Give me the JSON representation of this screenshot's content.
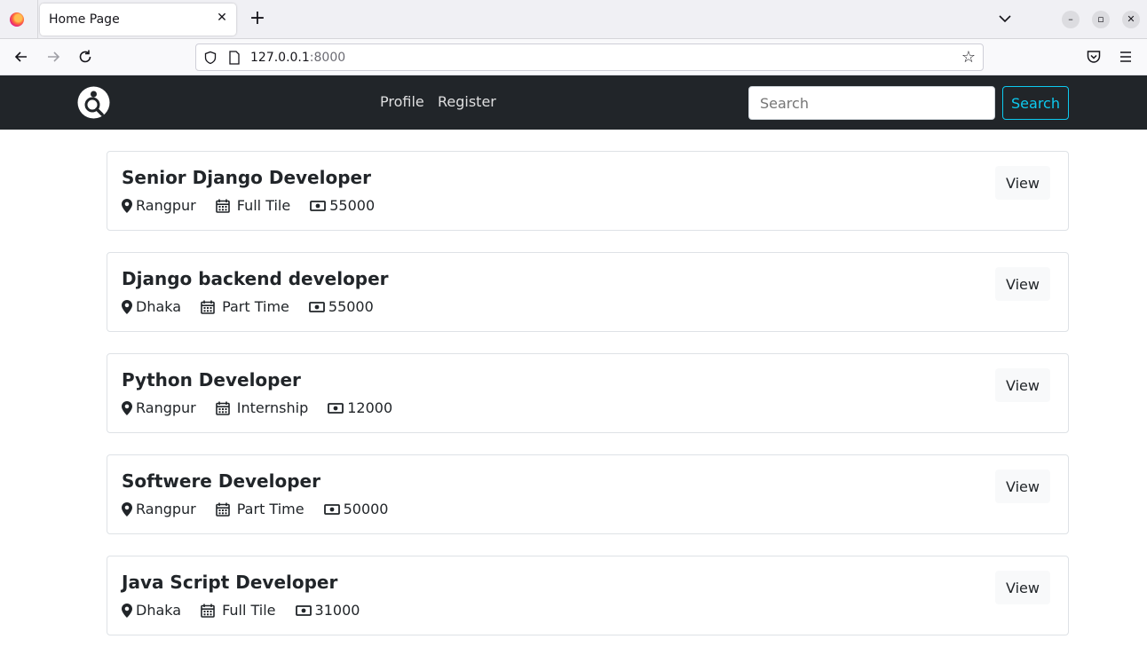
{
  "browser": {
    "tab_title": "Home Page",
    "tab_close": "✕",
    "new_tab": "+",
    "url_host": "127.0.0.1",
    "url_port": ":8000",
    "win_min": "–",
    "win_max": "▫",
    "win_close": "✕"
  },
  "nav": {
    "links": [
      "Profile",
      "Register"
    ],
    "search_placeholder": "Search",
    "search_button": "Search"
  },
  "jobs": [
    {
      "title": "Senior Django Developer",
      "location": "Rangpur",
      "type": "Full Tile",
      "salary": "55000",
      "button": "View"
    },
    {
      "title": "Django backend developer",
      "location": "Dhaka",
      "type": "Part Time",
      "salary": "55000",
      "button": "View"
    },
    {
      "title": "Python Developer",
      "location": "Rangpur",
      "type": "Internship",
      "salary": "12000",
      "button": "View"
    },
    {
      "title": "Softwere Developer",
      "location": "Rangpur",
      "type": "Part Time",
      "salary": "50000",
      "button": "View"
    },
    {
      "title": "Java Script Developer",
      "location": "Dhaka",
      "type": "Full Tile",
      "salary": "31000",
      "button": "View"
    }
  ],
  "colors": {
    "navbar_bg": "#212529",
    "accent": "#0dcaf0"
  }
}
